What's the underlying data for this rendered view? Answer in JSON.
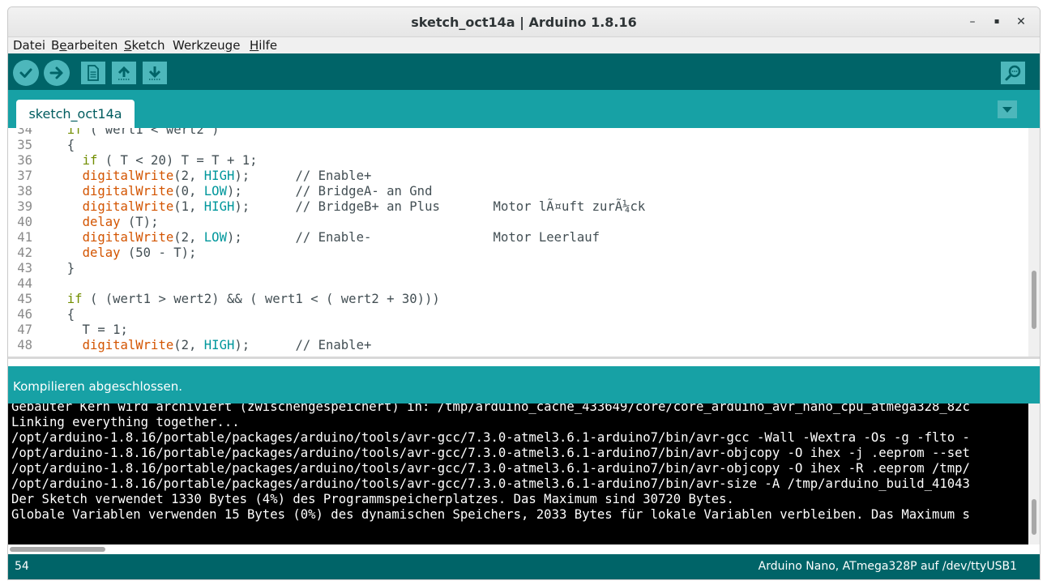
{
  "window": {
    "title": "sketch_oct14a | Arduino 1.8.16",
    "minimize_glyph": "–",
    "maximize_glyph": "▪",
    "close_glyph": "✕"
  },
  "menu": [
    {
      "pre": "Datei",
      "u": "",
      "post": ""
    },
    {
      "pre": "B",
      "u": "e",
      "post": "arbeiten"
    },
    {
      "pre": "",
      "u": "S",
      "post": "ketch"
    },
    {
      "pre": "Werkzeu",
      "u": "g",
      "post": "e"
    },
    {
      "pre": "",
      "u": "H",
      "post": "ilfe"
    }
  ],
  "toolbar": {
    "icons": [
      "verify-check-icon",
      "upload-arrow-icon",
      "new-file-icon",
      "open-arrow-up-icon",
      "save-arrow-down-icon",
      "serial-monitor-magnifier-icon"
    ],
    "accent": "#4db7bb",
    "bg": "#006468"
  },
  "tab": {
    "label": "sketch_oct14a"
  },
  "editor": {
    "lines": [
      {
        "n": "34",
        "parts": [
          [
            "",
            "  "
          ],
          [
            "ctl",
            "if"
          ],
          [
            "",
            " ( wert1 < wert2 )"
          ]
        ]
      },
      {
        "n": "35",
        "parts": [
          [
            "",
            "  {"
          ]
        ]
      },
      {
        "n": "36",
        "parts": [
          [
            "",
            "    "
          ],
          [
            "ctl",
            "if"
          ],
          [
            "",
            " ( T < 20) T = T + 1;"
          ]
        ]
      },
      {
        "n": "37",
        "parts": [
          [
            "",
            "    "
          ],
          [
            "fn",
            "digitalWrite"
          ],
          [
            "",
            "(2, "
          ],
          [
            "const",
            "HIGH"
          ],
          [
            "",
            ");      // Enable+"
          ]
        ]
      },
      {
        "n": "38",
        "parts": [
          [
            "",
            "    "
          ],
          [
            "fn",
            "digitalWrite"
          ],
          [
            "",
            "(0, "
          ],
          [
            "const",
            "LOW"
          ],
          [
            "",
            ");       // BridgeA- an Gnd"
          ]
        ]
      },
      {
        "n": "39",
        "parts": [
          [
            "",
            "    "
          ],
          [
            "fn",
            "digitalWrite"
          ],
          [
            "",
            "(1, "
          ],
          [
            "const",
            "HIGH"
          ],
          [
            "",
            ");      // BridgeB+ an Plus       Motor lÃ¤uft zurÃ¼ck"
          ]
        ]
      },
      {
        "n": "40",
        "parts": [
          [
            "",
            "    "
          ],
          [
            "fn",
            "delay"
          ],
          [
            "",
            " (T);"
          ]
        ]
      },
      {
        "n": "41",
        "parts": [
          [
            "",
            "    "
          ],
          [
            "fn",
            "digitalWrite"
          ],
          [
            "",
            "(2, "
          ],
          [
            "const",
            "LOW"
          ],
          [
            "",
            ");       // Enable-                Motor Leerlauf"
          ]
        ]
      },
      {
        "n": "42",
        "parts": [
          [
            "",
            "    "
          ],
          [
            "fn",
            "delay"
          ],
          [
            "",
            " (50 - T);"
          ]
        ]
      },
      {
        "n": "43",
        "parts": [
          [
            "",
            "  }"
          ]
        ]
      },
      {
        "n": "44",
        "parts": [
          [
            "",
            ""
          ]
        ]
      },
      {
        "n": "45",
        "parts": [
          [
            "",
            "  "
          ],
          [
            "ctl",
            "if"
          ],
          [
            "",
            " ( (wert1 > wert2) && ( wert1 < ( wert2 + 30)))"
          ]
        ]
      },
      {
        "n": "46",
        "parts": [
          [
            "",
            "  {"
          ]
        ]
      },
      {
        "n": "47",
        "parts": [
          [
            "",
            "    T = 1;"
          ]
        ]
      },
      {
        "n": "48",
        "parts": [
          [
            "",
            "    "
          ],
          [
            "fn",
            "digitalWrite"
          ],
          [
            "",
            "(2, "
          ],
          [
            "const",
            "HIGH"
          ],
          [
            "",
            ");      // Enable+"
          ]
        ]
      }
    ]
  },
  "status": {
    "message": "Kompilieren abgeschlossen."
  },
  "console": {
    "lines": [
      "Gebauter Kern wird archiviert (zwischengespeichert) in: /tmp/arduino_cache_433649/core/core_arduino_avr_nano_cpu_atmega328_82c",
      "Linking everything together...",
      "/opt/arduino-1.8.16/portable/packages/arduino/tools/avr-gcc/7.3.0-atmel3.6.1-arduino7/bin/avr-gcc -Wall -Wextra -Os -g -flto -",
      "/opt/arduino-1.8.16/portable/packages/arduino/tools/avr-gcc/7.3.0-atmel3.6.1-arduino7/bin/avr-objcopy -O ihex -j .eeprom --set",
      "/opt/arduino-1.8.16/portable/packages/arduino/tools/avr-gcc/7.3.0-atmel3.6.1-arduino7/bin/avr-objcopy -O ihex -R .eeprom /tmp/",
      "/opt/arduino-1.8.16/portable/packages/arduino/tools/avr-gcc/7.3.0-atmel3.6.1-arduino7/bin/avr-size -A /tmp/arduino_build_41043",
      "Der Sketch verwendet 1330 Bytes (4%) des Programmspeicherplatzes. Das Maximum sind 30720 Bytes.",
      "Globale Variablen verwenden 15 Bytes (0%) des dynamischen Speichers, 2033 Bytes für lokale Variablen verbleiben. Das Maximum s"
    ]
  },
  "footer": {
    "line_number": "54",
    "board": "Arduino Nano, ATmega328P auf /dev/ttyUSB1"
  }
}
